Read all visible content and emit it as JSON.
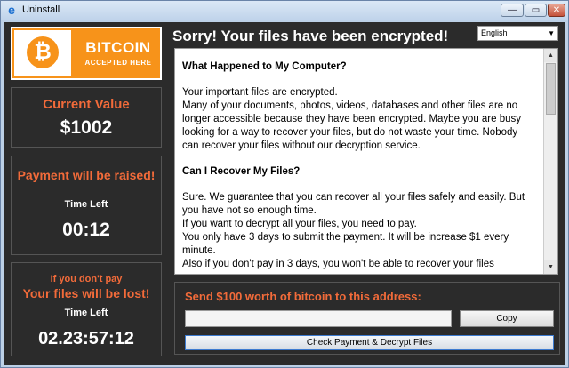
{
  "window": {
    "title": "Uninstall",
    "app_icon": "ie-icon",
    "controls": {
      "minimize": "—",
      "maximize": "▭",
      "close": "✕"
    }
  },
  "logo": {
    "brand": "BITCOIN",
    "sub": "ACCEPTED HERE",
    "coin_symbol": "₿"
  },
  "current_value": {
    "label": "Current Value",
    "value": "$1002"
  },
  "raise": {
    "label": "Payment will be raised!",
    "time_left_label": "Time Left",
    "timer": "00:12"
  },
  "lost": {
    "line1": "If you don't pay",
    "line2": "Your files will be lost!",
    "time_left_label": "Time Left",
    "timer": "02.23:57:12"
  },
  "headline": "Sorry! Your files have been encrypted!",
  "language": {
    "selected": "English"
  },
  "content": {
    "heading1": "What Happened to My Computer?",
    "para1_line1": "Your important files are encrypted.",
    "para1_line2": "Many of your documents, photos, videos, databases and other files are no",
    "para1_line3": "longer accessible because they have been encrypted. Maybe you are busy",
    "para1_line4": "looking for a way to recover your files, but do not waste your time. Nobody",
    "para1_line5": "can recover your files without our decryption service.",
    "heading2": "Can I Recover My Files?",
    "para2_line1": "Sure. We guarantee that you can recover all your files safely and easily. But",
    "para2_line2": "you have not so enough time.",
    "para2_line3": "If you want to decrypt all your files, you need to pay.",
    "para2_line4": "You only have 3 days to submit the payment. It will be increase $1 every",
    "para2_line5": "minute.",
    "para2_line6": "Also if you don't pay in 3 days, you won't be able to recover your files"
  },
  "payment": {
    "address_label": "Send $100 worth of bitcoin to this address:",
    "address_value": "",
    "copy_label": "Copy",
    "check_label": "Check Payment & Decrypt Files"
  },
  "colors": {
    "accent": "#f26b3a",
    "bitcoin_orange": "#f7931a",
    "background": "#2b2b2b"
  }
}
